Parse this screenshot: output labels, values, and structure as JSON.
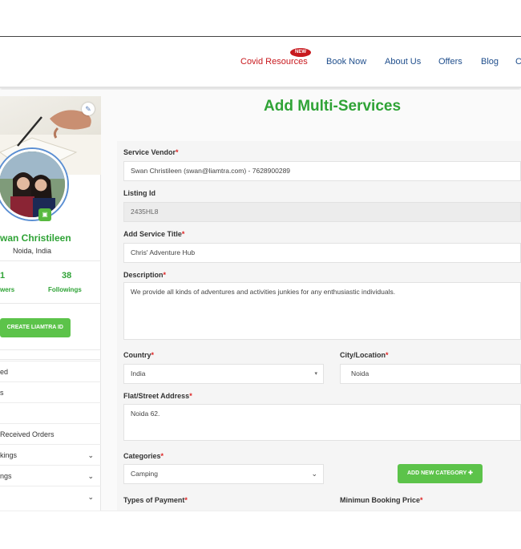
{
  "nav": {
    "items": [
      "Covid Resources",
      "Book Now",
      "About Us",
      "Offers",
      "Blog",
      "C"
    ],
    "new_badge": "NEW",
    "accent": "#c8191e",
    "link_color": "#1f4e8c"
  },
  "profile": {
    "name": "wan Christileen",
    "location": "Noida, India",
    "followers_count": "1",
    "followers_label": "wers",
    "followings_count": "38",
    "followings_label": "Followings",
    "create_button": "CREATE LIAMTRA ID"
  },
  "sidebar_menu": [
    {
      "label": "ed",
      "chevron": false
    },
    {
      "label": "s",
      "chevron": false
    },
    {
      "label": "",
      "chevron": false
    },
    {
      "label": " Received Orders",
      "chevron": false
    },
    {
      "label": "kings",
      "chevron": true
    },
    {
      "label": "ngs",
      "chevron": true
    },
    {
      "label": "",
      "chevron": true
    }
  ],
  "page": {
    "title": "Add Multi-Services",
    "accent_green": "#2fa336"
  },
  "form": {
    "service_vendor": {
      "label": "Service Vendor",
      "value": "Swan Christileen (swan@liamtra.com) - 7628900289"
    },
    "listing_id": {
      "label": "Listing Id",
      "value": "2435HL8"
    },
    "service_title": {
      "label": "Add Service Title",
      "value": "Chris' Adventure Hub"
    },
    "description": {
      "label": "Description",
      "value": "We provide all kinds of adventures and activities junkies for any enthusiastic individuals."
    },
    "country": {
      "label": "Country",
      "value": "India"
    },
    "city": {
      "label": "City/Location",
      "value": "Noida"
    },
    "street": {
      "label": "Flat/Street Address",
      "value": "Noida 62."
    },
    "categories": {
      "label": "Categories",
      "value": "Camping"
    },
    "add_category_button": "ADD NEW CATEGORY",
    "payment_types": {
      "label": "Types of Payment"
    },
    "min_price": {
      "label": "Minimun Booking Price"
    },
    "required_mark": "*"
  }
}
